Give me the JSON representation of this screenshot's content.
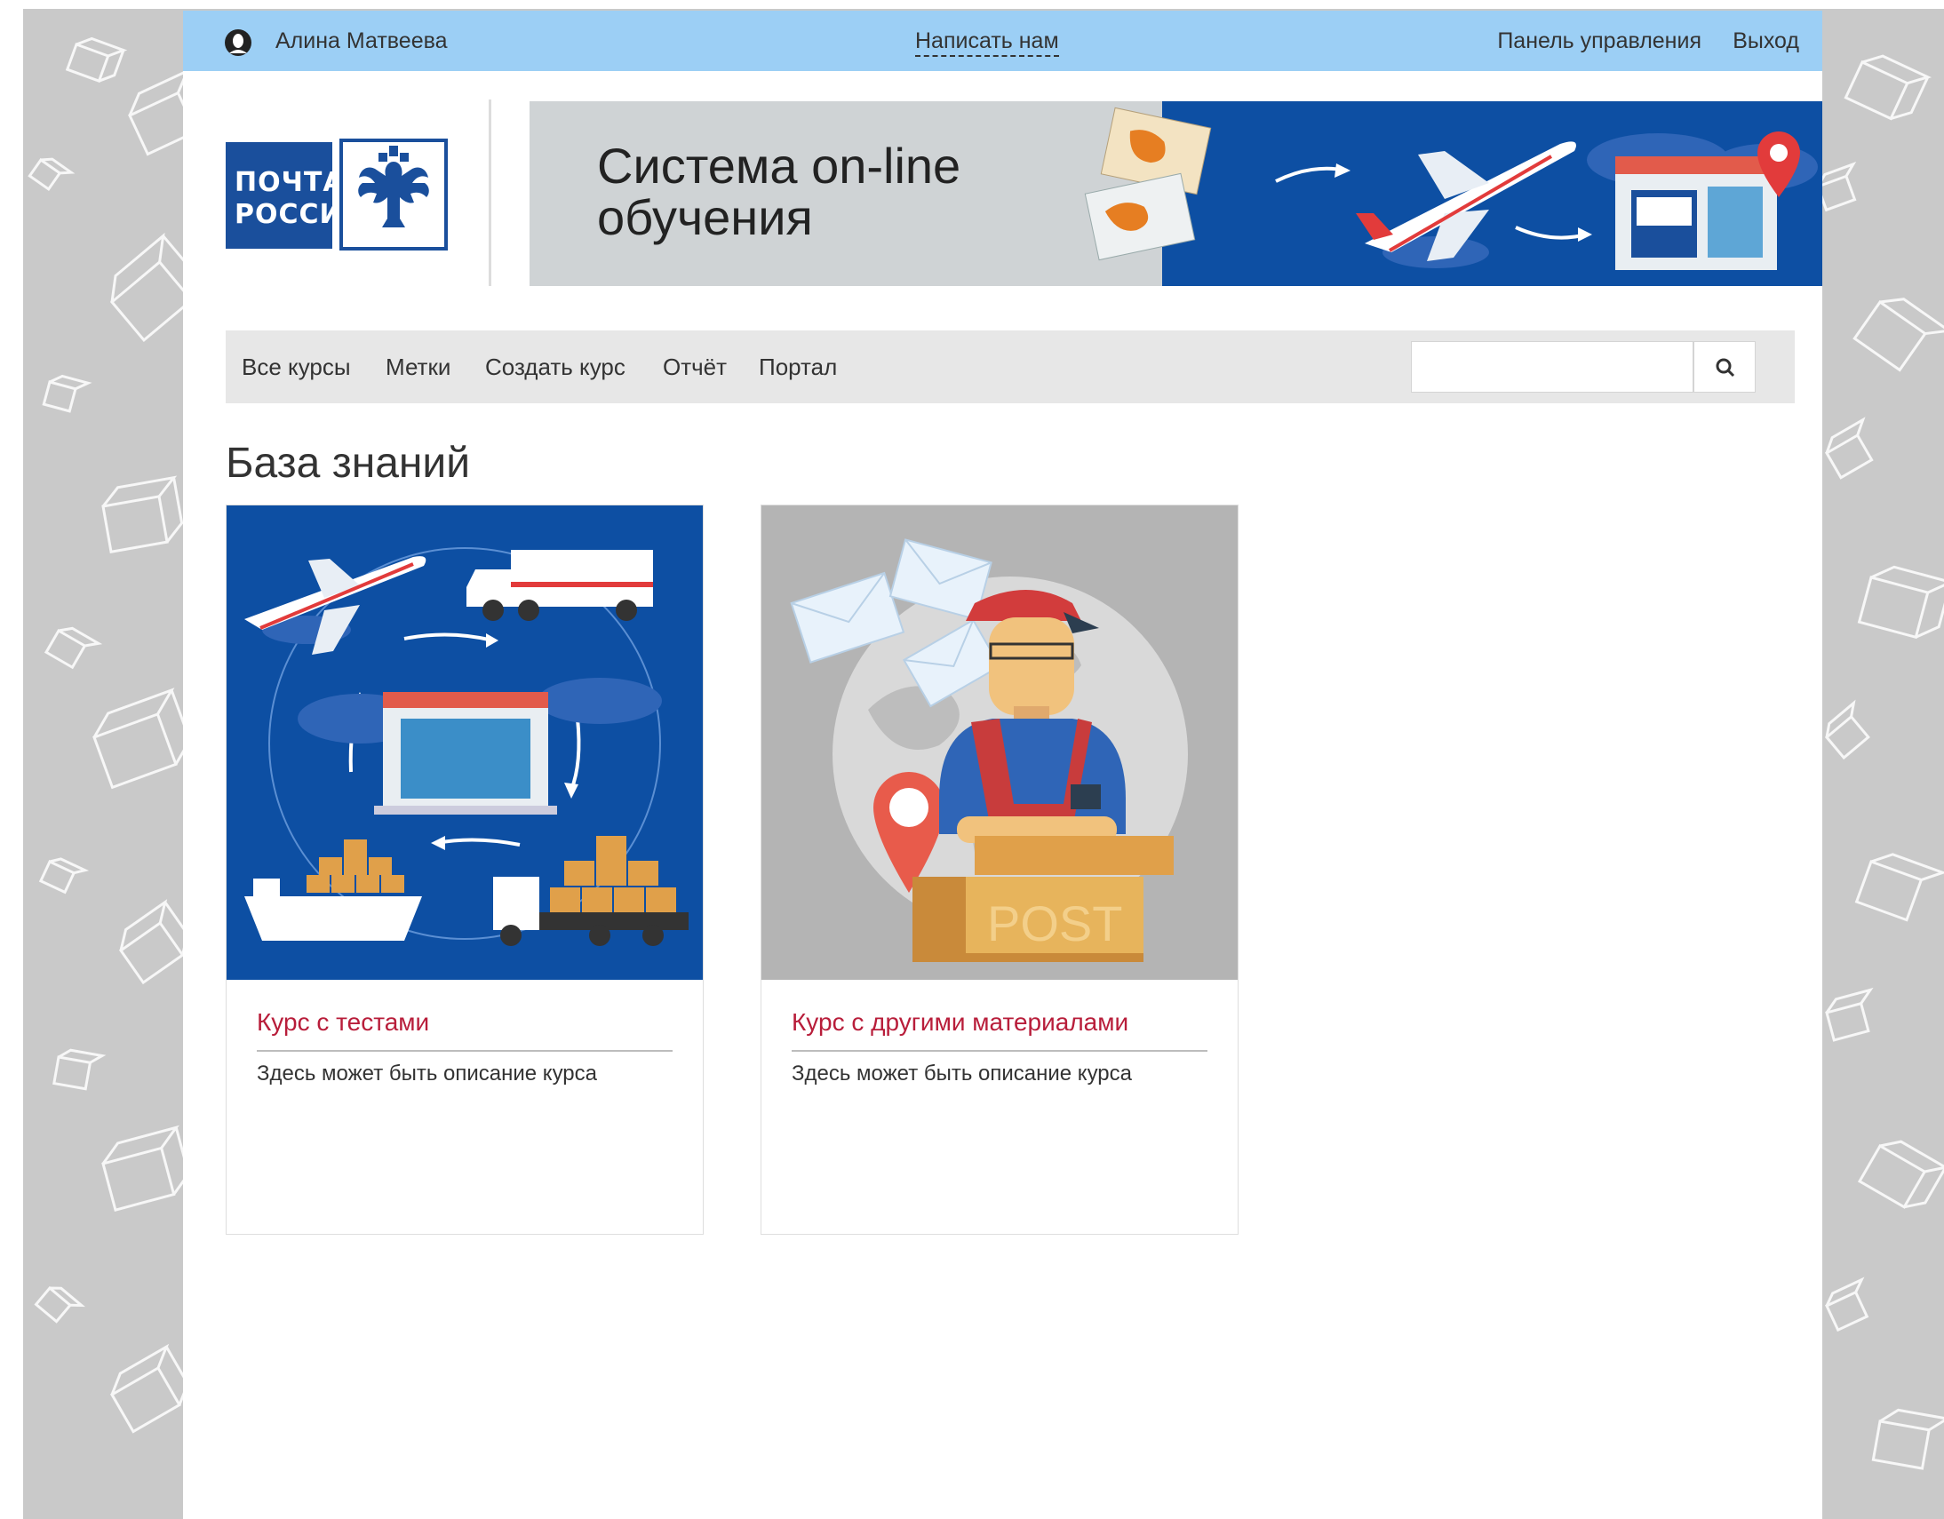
{
  "topbar": {
    "user_name": "Алина Матвеева",
    "contact_link": "Написать нам",
    "control_panel": "Панель управления",
    "logout": "Выход"
  },
  "logo": {
    "line1": "ПОЧТА",
    "line2": "РОССИИ"
  },
  "banner": {
    "title_line1": "Система on-line",
    "title_line2": "обучения"
  },
  "nav": {
    "items": [
      "Все курсы",
      "Метки",
      "Создать курс",
      "Отчёт",
      "Портал"
    ],
    "search_placeholder": ""
  },
  "page": {
    "title": "База знаний"
  },
  "cards": [
    {
      "title": "Курс с тестами",
      "description": "Здесь может быть описание курса"
    },
    {
      "title": "Курс с другими материалами",
      "description": "Здесь может быть описание курса",
      "image_text": "POST"
    }
  ],
  "colors": {
    "topbar": "#9ccff5",
    "brand_blue": "#0d4fa3",
    "card_title": "#b81d3a",
    "page_bg": "#c9c9c9"
  }
}
